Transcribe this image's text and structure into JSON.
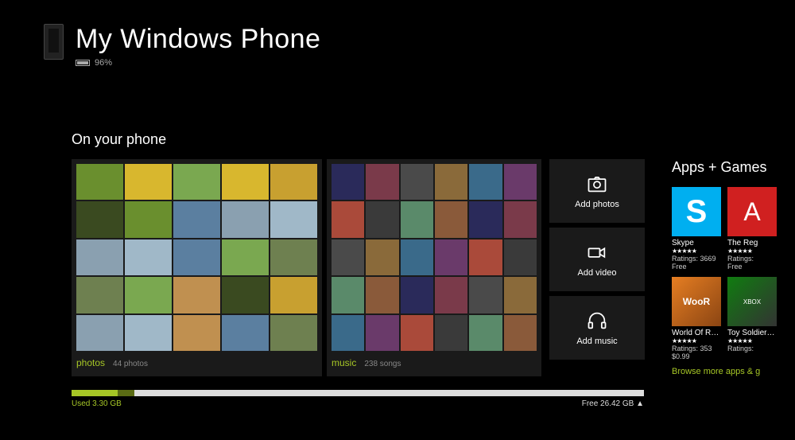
{
  "header": {
    "title": "My Windows Phone",
    "battery_percent": "96%"
  },
  "section": {
    "on_phone": "On your phone",
    "apps_games": "Apps + Games"
  },
  "panels": {
    "photos": {
      "label": "photos",
      "count": "44 photos"
    },
    "music": {
      "label": "music",
      "count": "238 songs"
    }
  },
  "actions": {
    "add_photos": "Add photos",
    "add_video": "Add video",
    "add_music": "Add music"
  },
  "apps": [
    {
      "name": "Skype",
      "stars": "★★★★★",
      "ratings": "Ratings: 3669",
      "price": "Free"
    },
    {
      "name": "The Reg",
      "stars": "★★★★★",
      "ratings": "Ratings:",
      "price": "Free"
    },
    {
      "name": "World Of Rabbit - The",
      "stars": "★★★★★",
      "ratings": "Ratings: 353",
      "price": "$0.99"
    },
    {
      "name": "Toy Soldiers Boot Ca",
      "stars": "★★★★★",
      "ratings": "Ratings:",
      "price": ""
    }
  ],
  "browse_link": "Browse more apps & g",
  "storage": {
    "used": "Used 3.30 GB",
    "free": "Free 26.42 GB ▲",
    "used_pct": 8,
    "other_pct": 3,
    "free_pct": 89
  }
}
